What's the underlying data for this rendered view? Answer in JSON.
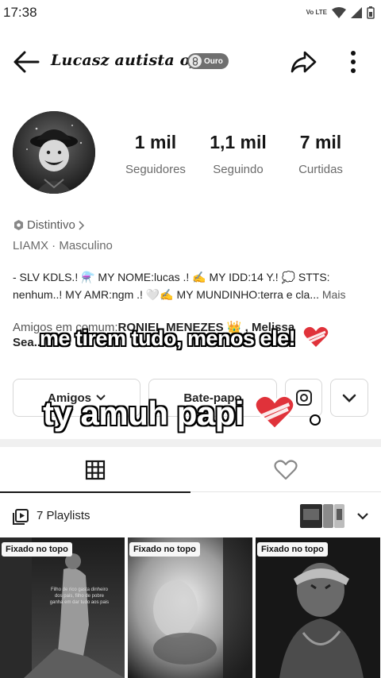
{
  "status_bar": {
    "time": "17:38",
    "volte": "Vo LTE"
  },
  "header": {
    "title": "Lucasz autista ofc",
    "badge_label": "Ouro"
  },
  "stats": [
    {
      "value": "1 mil",
      "label": "Seguidores"
    },
    {
      "value": "1,1 mil",
      "label": "Seguindo"
    },
    {
      "value": "7 mil",
      "label": "Curtidas"
    }
  ],
  "profile": {
    "distintivo": "Distintivo",
    "meta": "LIAMX · Masculino",
    "bio_line1": "- SLV KDLS.! ⚗️  MY NOME:lucas .! ✍️  MY IDD:14  Y.! 💭  STTS:",
    "bio_line2": "nenhum..!  MY AMR:ngm  .! 🤍✍️  MY MUNDINHO:terra e cla...",
    "more": "Mais",
    "mutual_prefix": "Amigos em comum:",
    "mutual_names": "RONIEL MENEZES 👑 , Melissa",
    "mutual_line2": "Sea..."
  },
  "actions": {
    "amigos": "Amigos",
    "bate_papo": "Bate-papo"
  },
  "playlists": {
    "label": "7 Playlists"
  },
  "videos": [
    {
      "badge": "Fixado no topo",
      "caption": "Filho de rico gasta dinheiro dos pais, filho de pobre ganha em dar tudo aos pais"
    },
    {
      "badge": "Fixado no topo"
    },
    {
      "badge": "Fixado no topo"
    }
  ],
  "overlay": {
    "line1": "me tirem tudo, menos ele!",
    "line2": "ty amuh papi"
  },
  "colors": {
    "heart_red": "#e0323a",
    "background": "#ffffff"
  }
}
